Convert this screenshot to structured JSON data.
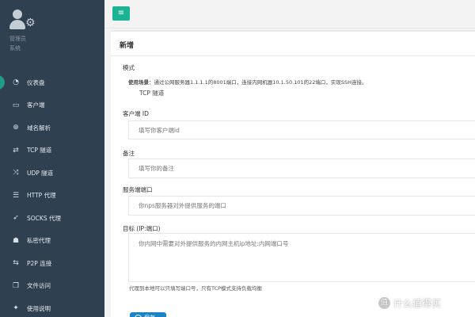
{
  "sidebar": {
    "profile": {
      "name": "管理员",
      "role": "系统"
    },
    "items": [
      {
        "label": "仪表盘",
        "icon": "dashboard-icon",
        "glyph": "◔",
        "active": true
      },
      {
        "label": "客户端",
        "icon": "monitor-icon",
        "glyph": "▭"
      },
      {
        "label": "域名解析",
        "icon": "globe-icon",
        "glyph": "⊕"
      },
      {
        "label": "TCP 隧道",
        "icon": "retweet-icon",
        "glyph": "⇄"
      },
      {
        "label": "UDP 隧道",
        "icon": "shuffle-icon",
        "glyph": "⤨"
      },
      {
        "label": "HTTP 代理",
        "icon": "server-icon",
        "glyph": "☰"
      },
      {
        "label": "SOCKS 代理",
        "icon": "rocket-icon",
        "glyph": "➶"
      },
      {
        "label": "私密代理",
        "icon": "user-secret-icon",
        "glyph": "☗"
      },
      {
        "label": "P2P 连接",
        "icon": "exchange-icon",
        "glyph": "⇆"
      },
      {
        "label": "文件访问",
        "icon": "file-icon",
        "glyph": "❐"
      },
      {
        "label": "使用说明",
        "icon": "lightbulb-icon",
        "glyph": "✦"
      }
    ]
  },
  "topbar": {
    "menu_icon": "bars-icon",
    "menu_glyph": "≡"
  },
  "form": {
    "title": "新增",
    "mode": {
      "label": "模式",
      "help_prefix": "使用场景",
      "help_text": "：通过公网服务器1.1.1.1的8001端口，连接内网机器10.1.50.101的22端口，实现SSH连接。",
      "value": "TCP 隧道"
    },
    "client_id": {
      "label": "客户端 ID",
      "placeholder": "填写你客户端id"
    },
    "remark": {
      "label": "备注",
      "placeholder": "填写你的备注"
    },
    "server_port": {
      "label": "服务端端口",
      "placeholder": "你nps服务器对外提供服务的端口"
    },
    "target": {
      "label": "目标 (IP:端口)",
      "placeholder": "你内网中需要对外提供服务的内网主机ip地址:内网端口号",
      "note": "代理到本地可以只填写端口号，只有TCP模式支持负载均衡"
    },
    "save_label": "保存"
  },
  "watermark": {
    "text": "什么值得买",
    "glyph": "值"
  },
  "colors": {
    "sidebar_bg": "#2f4050",
    "accent": "#1ab394",
    "primary": "#1c84c6"
  }
}
